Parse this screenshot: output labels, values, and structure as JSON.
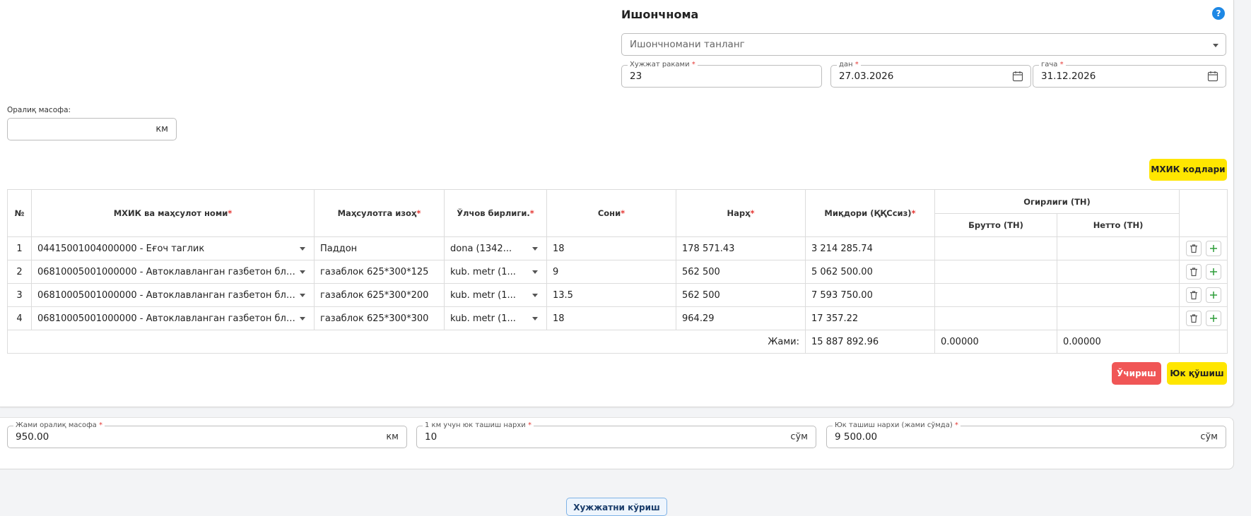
{
  "trust": {
    "title": "Ишончнома",
    "select_placeholder": "Ишончномани танланг",
    "doc_number": {
      "label": "Хужжат раками",
      "value": "23"
    },
    "date_from": {
      "label": "дан",
      "value": "27.03.2026"
    },
    "date_to": {
      "label": "гача",
      "value": "31.12.2026"
    },
    "help": "?"
  },
  "distance": {
    "label": "Оралиқ масофа:",
    "value": "",
    "unit": "км"
  },
  "mxik_button": "МХИК кодлари",
  "table": {
    "headers": {
      "num": "№",
      "product": "МХИК ва маҳсулот номи",
      "description": "Маҳсулотга изоҳ",
      "unit": "Ўлчов бирлиги.",
      "qty": "Сони",
      "price": "Нарҳ",
      "amount": "Миқдори (ҚҚСсиз)",
      "weight_group": "Огирлиги (ТН)",
      "gross": "Брутто (ТН)",
      "net": "Нетто (ТН)"
    },
    "rows": [
      {
        "num": "1",
        "product": "04415001004000000 - Ёғоч таглик",
        "description": "Паддон",
        "unit": "dona (1342...",
        "qty": "18",
        "price": "178 571.43",
        "amount": "3 214 285.74",
        "gross": "",
        "net": ""
      },
      {
        "num": "2",
        "product": "06810005001000000 - Автоклавланган газбетон бло...",
        "description": "газаблок 625*300*125",
        "unit": "kub. metr (1...",
        "qty": "9",
        "price": "562 500",
        "amount": "5 062 500.00",
        "gross": "",
        "net": ""
      },
      {
        "num": "3",
        "product": "06810005001000000 - Автоклавланган газбетон бло...",
        "description": "газаблок 625*300*200",
        "unit": "kub. metr (1...",
        "qty": "13.5",
        "price": "562 500",
        "amount": "7 593 750.00",
        "gross": "",
        "net": ""
      },
      {
        "num": "4",
        "product": "06810005001000000 - Автоклавланган газбетон бло...",
        "description": "газаблок 625*300*300",
        "unit": "kub. metr (1...",
        "qty": "18",
        "price": "964.29",
        "amount": "17 357.22",
        "gross": "",
        "net": ""
      }
    ],
    "total": {
      "label": "Жами:",
      "amount": "15 887 892.96",
      "gross": "0.00000",
      "net": "0.00000"
    }
  },
  "actions": {
    "delete": "Ўчириш",
    "add_cargo": "Юк қўшиш"
  },
  "transport": {
    "total_distance": {
      "label": "Жами оралиқ масофа",
      "value": "950.00",
      "unit": "км"
    },
    "price_per_km": {
      "label": "1 км учун юк ташиш нархи",
      "value": "10",
      "unit": "сўм"
    },
    "total_price": {
      "label": "Юк ташиш нархи (жами сўмда)",
      "value": "9 500.00",
      "unit": "сўм"
    }
  },
  "view_document": "Хужжатни кўриш"
}
